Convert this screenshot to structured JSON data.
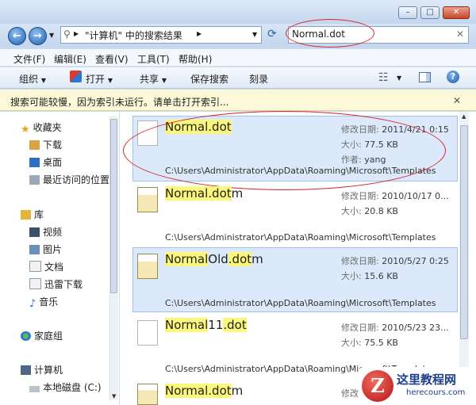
{
  "navigation": {
    "address": "\"计算机\" 中的搜索结果",
    "search_value": "Normal.dot"
  },
  "menu": [
    "文件(F)",
    "编辑(E)",
    "查看(V)",
    "工具(T)",
    "帮助(H)"
  ],
  "toolbar": {
    "organize": "组织",
    "open": "打开",
    "share": "共享",
    "save_search": "保存搜索",
    "burn": "刻录"
  },
  "infobar": {
    "message": "搜索可能较慢，因为索引未运行。请单击打开索引..."
  },
  "sidebar": {
    "favorites": {
      "label": "收藏夹",
      "items": [
        "下载",
        "桌面",
        "最近访问的位置"
      ]
    },
    "libraries": {
      "label": "库",
      "items": [
        "视频",
        "图片",
        "文档",
        "迅雷下载",
        "音乐"
      ]
    },
    "homegroup": "家庭组",
    "computer": {
      "label": "计算机",
      "items": [
        "本地磁盘 (C:)"
      ]
    }
  },
  "results": [
    {
      "name_hl": "Normal",
      "name_rest": ".dot",
      "name_tail": "",
      "modified_label": "修改日期:",
      "modified": "2011/4/21 0:15",
      "size_label": "大小:",
      "size": "77.5 KB",
      "author_label": "作者:",
      "author": "yang",
      "path": "C:\\Users\\Administrator\\AppData\\Roaming\\Microsoft\\Templates"
    },
    {
      "name_hl": "Normal",
      "name_rest": ".dot",
      "name_tail": "m",
      "modified_label": "修改日期:",
      "modified": "2010/10/17 0...",
      "size_label": "大小:",
      "size": "20.8 KB",
      "path": "C:\\Users\\Administrator\\AppData\\Roaming\\Microsoft\\Templates"
    },
    {
      "name_hl": "Normal",
      "name_mid": "Old",
      "name_rest": ".dot",
      "name_tail": "m",
      "modified_label": "修改日期:",
      "modified": "2010/5/27 0:25",
      "size_label": "大小:",
      "size": "15.6 KB",
      "path": "C:\\Users\\Administrator\\AppData\\Roaming\\Microsoft\\Templates"
    },
    {
      "name_hl": "Normal",
      "name_mid": "11",
      "name_rest": ".dot",
      "name_tail": "",
      "modified_label": "修改日期:",
      "modified": "2010/5/23 23...",
      "size_label": "大小:",
      "size": "75.5 KB",
      "path": "C:\\Users\\Administrator\\AppData\\Roaming\\Microsoft\\Templates"
    },
    {
      "name_hl": "Normal",
      "name_rest": ".dot",
      "name_tail": "m",
      "modified_label": "修改日期:"
    }
  ],
  "watermark": {
    "title": "这里教程网",
    "url": "herecours.com"
  },
  "colors": {
    "highlight": "#fbf77d",
    "annotation": "#d9242b",
    "selection": "#dbe9fb"
  }
}
